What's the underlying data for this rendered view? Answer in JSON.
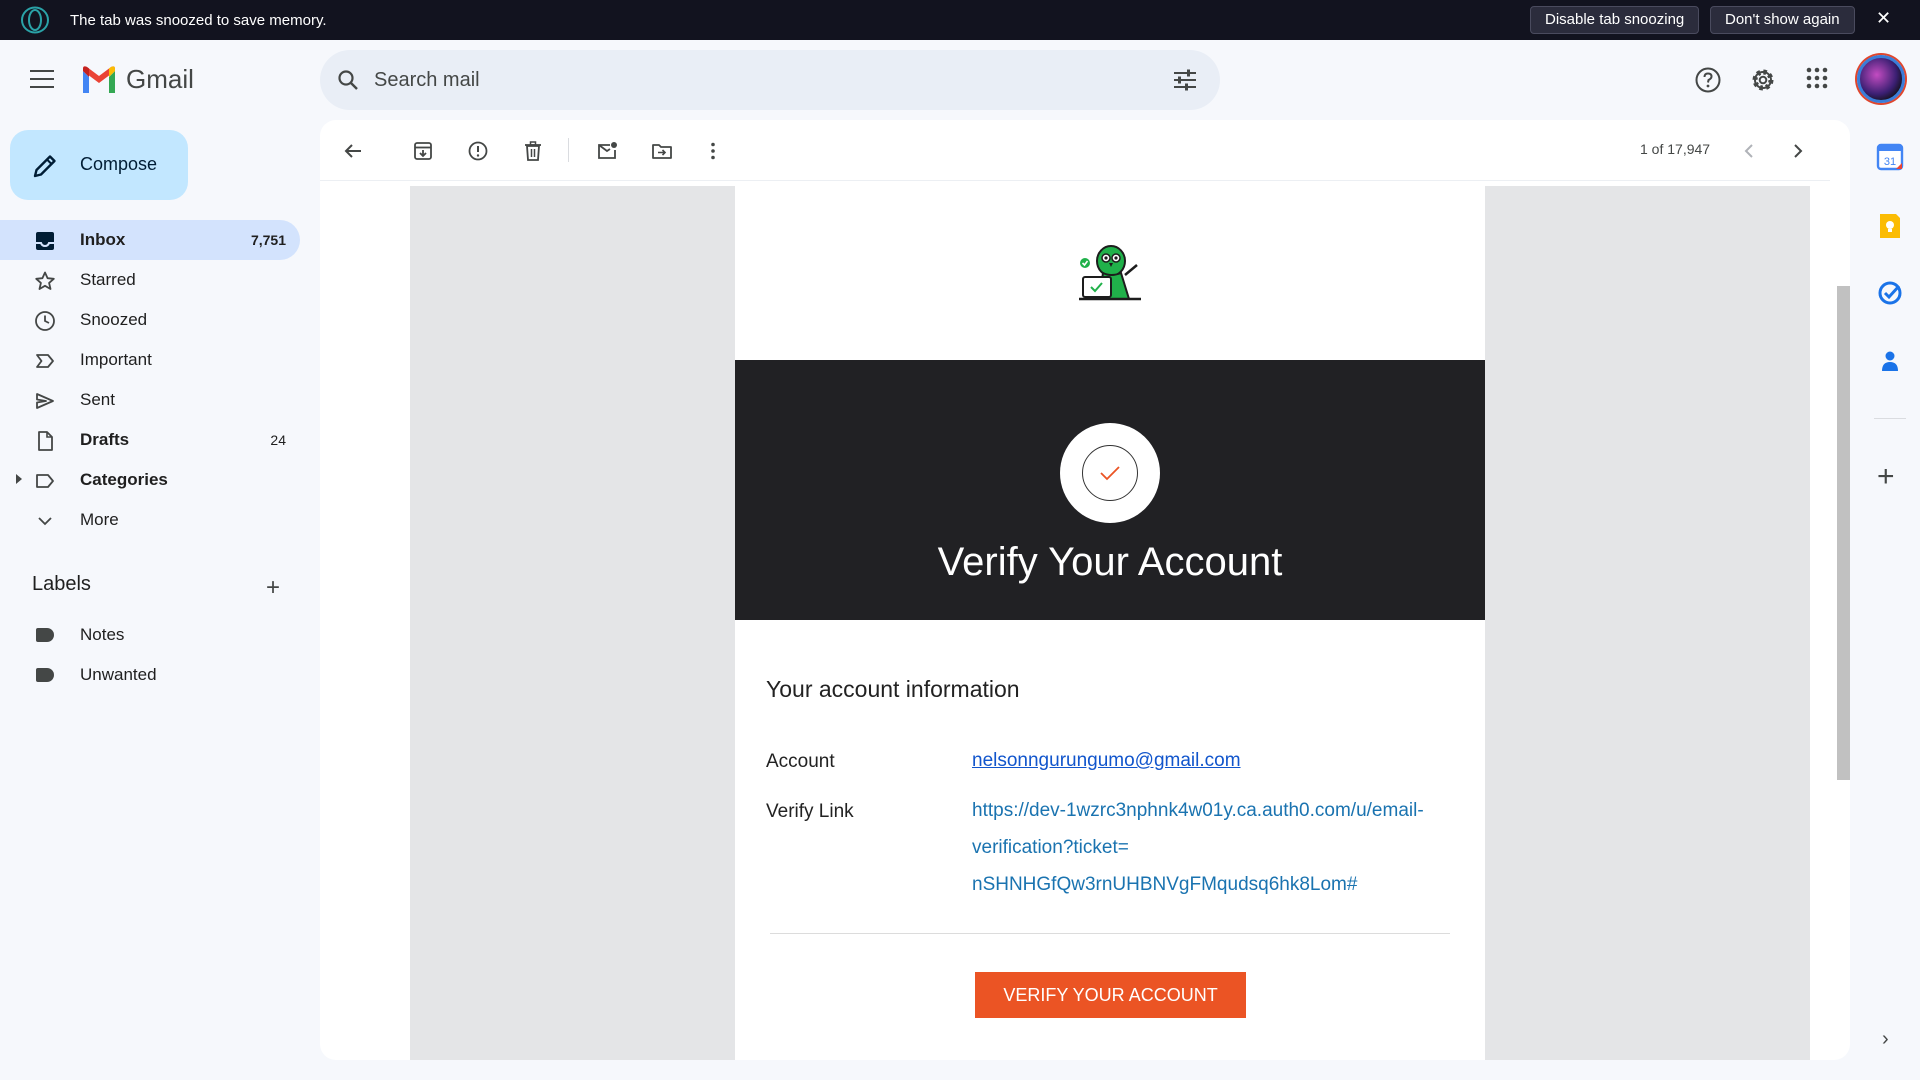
{
  "banner": {
    "message": "The tab was snoozed to save memory.",
    "disable_label": "Disable tab snoozing",
    "dont_show_label": "Don't show again"
  },
  "header": {
    "app_name": "Gmail",
    "search_placeholder": "Search mail"
  },
  "sidebar": {
    "compose_label": "Compose",
    "items": [
      {
        "label": "Inbox",
        "count": "7,751"
      },
      {
        "label": "Starred",
        "count": ""
      },
      {
        "label": "Snoozed",
        "count": ""
      },
      {
        "label": "Important",
        "count": ""
      },
      {
        "label": "Sent",
        "count": ""
      },
      {
        "label": "Drafts",
        "count": "24"
      },
      {
        "label": "Categories",
        "count": ""
      },
      {
        "label": "More",
        "count": ""
      }
    ],
    "labels_heading": "Labels",
    "labels": [
      {
        "label": "Notes"
      },
      {
        "label": "Unwanted"
      }
    ]
  },
  "toolbar": {
    "pager": "1 of 17,947"
  },
  "email": {
    "hero_title": "Verify Your Account",
    "info_title": "Your account information",
    "account_label": "Account",
    "account_value": "nelsonngurungumo@gmail.com",
    "verify_label": "Verify Link",
    "verify_line1": "https://dev-1wzrc3nphnk4w01y.ca.auth0.com/u/email-",
    "verify_line2": "verification?ticket=",
    "verify_line3": "nSHNHGfQw3rnUHBNVgFMqudsq6hk8Lom#",
    "cta_label": "VERIFY YOUR ACCOUNT",
    "colors": {
      "hero_bg": "#212124",
      "cta_bg": "#eb5424",
      "link": "#1a73b0"
    }
  },
  "side_panel": {
    "calendar_day": "31"
  }
}
